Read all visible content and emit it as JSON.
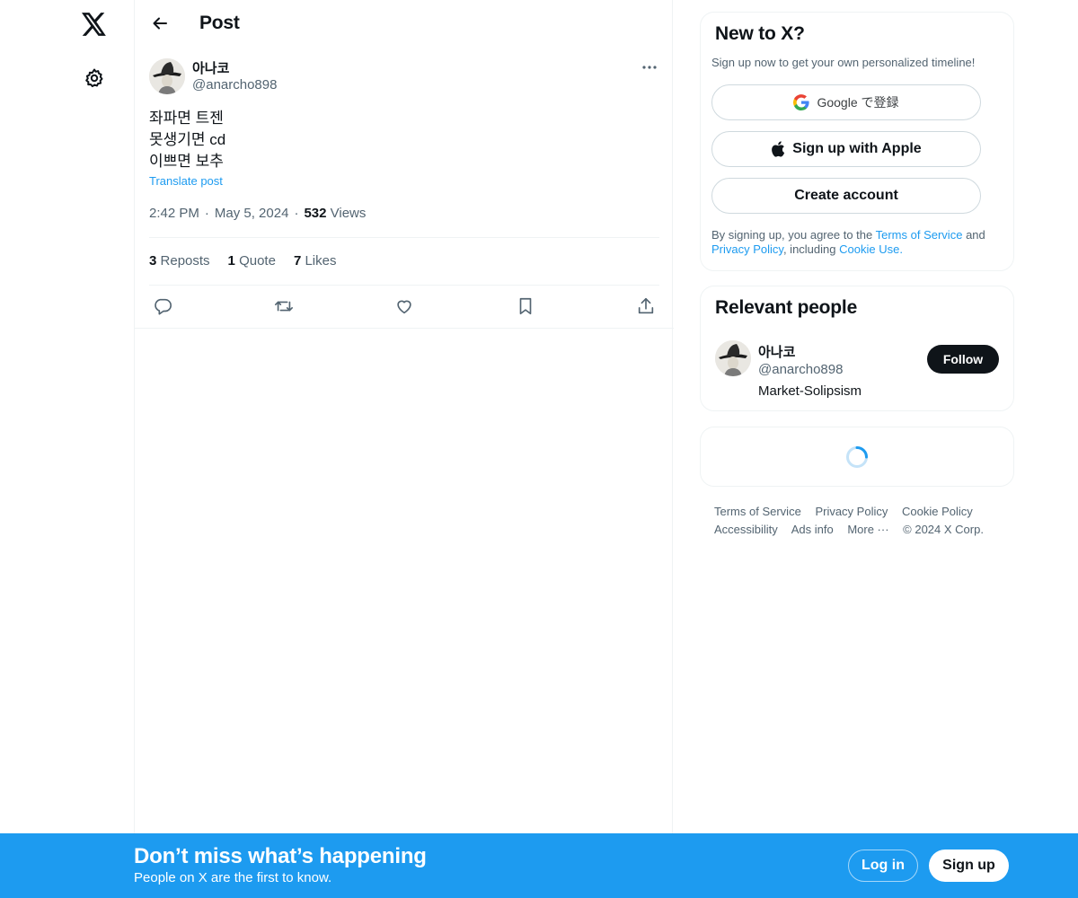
{
  "nav": {
    "logo_icon": "x-logo-icon",
    "settings_icon": "gear-icon"
  },
  "header": {
    "title": "Post",
    "back_icon": "arrow-left-icon"
  },
  "post": {
    "author_name": "아나코",
    "author_handle": "@anarcho898",
    "lines": [
      "좌파면 트젠",
      "못생기면 cd",
      "이쁘면 보추"
    ],
    "translate_label": "Translate post",
    "time": "2:42 PM",
    "date": "May 5, 2024",
    "views_count": "532",
    "views_label": "Views",
    "separator": "·",
    "stats": {
      "reposts_count": "3",
      "reposts_label": "Reposts",
      "quotes_count": "1",
      "quotes_label": "Quote",
      "likes_count": "7",
      "likes_label": "Likes"
    },
    "actions": [
      "reply-icon",
      "repost-icon",
      "like-icon",
      "bookmark-icon",
      "share-icon"
    ]
  },
  "sidebar": {
    "new_to_x": {
      "title": "New to X?",
      "subtitle": "Sign up now to get your own personalized timeline!",
      "google_label": "Google で登録",
      "apple_label": "Sign up with Apple",
      "create_label": "Create account",
      "legal_prefix": "By signing up, you agree to the",
      "terms_link": "Terms of Service",
      "legal_and": "and",
      "privacy_link": "Privacy Policy",
      "legal_including": ", including",
      "cookie_link": "Cookie Use."
    },
    "relevant_people": {
      "title": "Relevant people",
      "name": "아나코",
      "handle": "@anarcho898",
      "bio": "Market-Solipsism",
      "follow_label": "Follow"
    },
    "footer": {
      "terms": "Terms of Service",
      "privacy": "Privacy Policy",
      "cookie": "Cookie Policy",
      "accessibility": "Accessibility",
      "ads": "Ads info",
      "more": "More ···",
      "copyright": "© 2024 X Corp."
    }
  },
  "bottom_bar": {
    "title": "Don’t miss what’s happening",
    "subtitle": "People on X are the first to know.",
    "login_label": "Log in",
    "signup_label": "Sign up"
  },
  "colors": {
    "accent": "#1d9bf0",
    "text": "#0f1419",
    "muted": "#536471",
    "border": "#eff3f4"
  }
}
